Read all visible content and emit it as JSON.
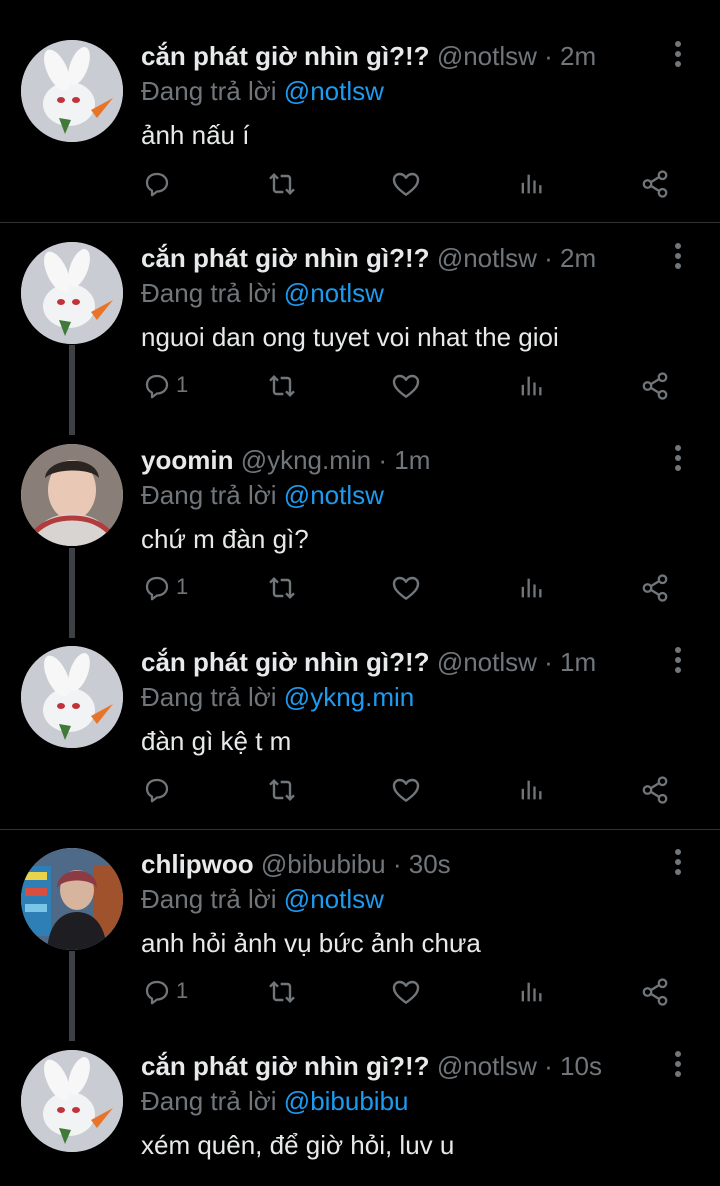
{
  "colors": {
    "background": "#000000",
    "text": "#e7e9ea",
    "muted": "#71767b",
    "accent": "#1d9bf0",
    "thread_line": "#3d4146"
  },
  "reply_prefix": "Đang trả lời",
  "tweets": [
    {
      "name": "cắn phát giờ nhìn gì?!?",
      "handle": "@notlsw",
      "time": "· 2m",
      "reply_to": "@notlsw",
      "text": "ảnh nấu í",
      "reply_count": "",
      "avatar": "white-bunny-avatar"
    },
    {
      "name": "cắn phát giờ nhìn gì?!?",
      "handle": "@notlsw",
      "time": "· 2m",
      "reply_to": "@notlsw",
      "text": "nguoi dan ong tuyet voi nhat the gioi",
      "reply_count": "1",
      "avatar": "white-bunny-avatar"
    },
    {
      "name": "yoomin",
      "handle": "@ykng.min",
      "time": "· 1m",
      "reply_to": "@notlsw",
      "text": "chứ m đàn gì?",
      "reply_count": "1",
      "avatar": "person-photo-avatar"
    },
    {
      "name": "cắn phát giờ nhìn gì?!?",
      "handle": "@notlsw",
      "time": "· 1m",
      "reply_to": "@ykng.min",
      "text": "đàn gì kệ t m",
      "reply_count": "",
      "avatar": "white-bunny-avatar"
    },
    {
      "name": "chlipwoo",
      "handle": "@bibubibu",
      "time": "· 30s",
      "reply_to": "@notlsw",
      "text": "anh hỏi ảnh vụ bức ảnh chưa",
      "reply_count": "1",
      "avatar": "person-photo-avatar"
    },
    {
      "name": "cắn phát giờ nhìn gì?!?",
      "handle": "@notlsw",
      "time": "· 10s",
      "reply_to": "@bibubibu",
      "text": "xém quên, để giờ hỏi, luv u",
      "reply_count": "",
      "avatar": "white-bunny-avatar"
    }
  ]
}
